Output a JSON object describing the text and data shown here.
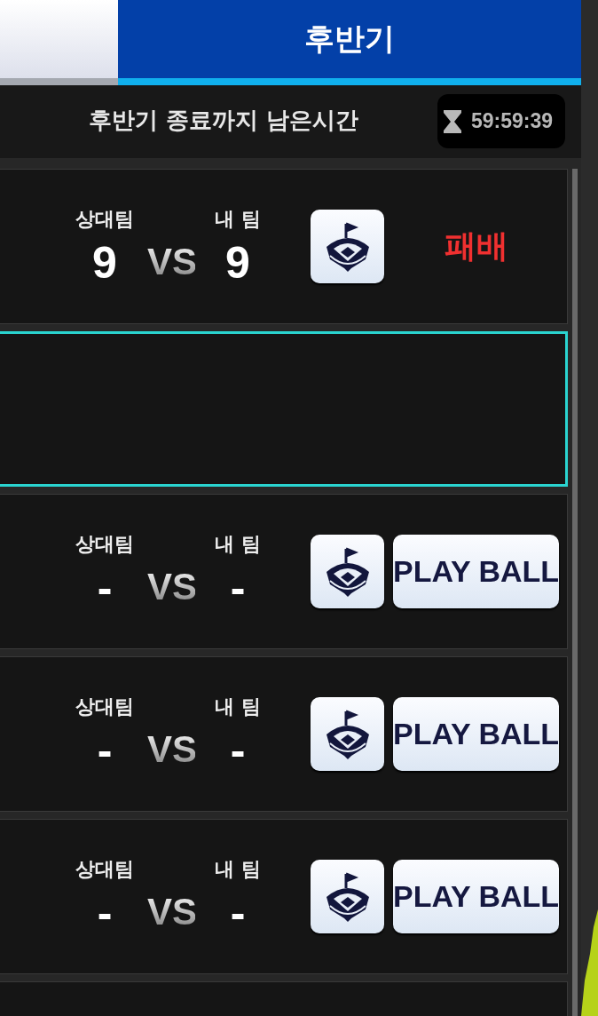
{
  "tabs": [
    {
      "selected": false
    },
    {
      "label": "후반기",
      "selected": true
    }
  ],
  "info_bar": {
    "label": "후반기 종료까지 남은시간",
    "timer": "59:59:39"
  },
  "matches": [
    {
      "kind": "result",
      "selected": false,
      "opponent_label": "상대팀",
      "my_label": "내 팀",
      "opponent_score": "9",
      "vs": "VS",
      "my_score": "9",
      "result": "패배",
      "color": "#f03030"
    },
    {
      "kind": "empty",
      "selected": true
    },
    {
      "kind": "pending",
      "selected": false,
      "opponent_label": "상대팀",
      "my_label": "내 팀",
      "opponent_score": "-",
      "vs": "VS",
      "my_score": "-",
      "button": "PLAY BALL"
    },
    {
      "kind": "pending",
      "selected": false,
      "opponent_label": "상대팀",
      "my_label": "내 팀",
      "opponent_score": "-",
      "vs": "VS",
      "my_score": "-",
      "button": "PLAY BALL"
    },
    {
      "kind": "pending",
      "selected": false,
      "opponent_label": "상대팀",
      "my_label": "내 팀",
      "opponent_score": "-",
      "vs": "VS",
      "my_score": "-",
      "button": "PLAY BALL"
    },
    {
      "kind": "cut",
      "selected": false
    }
  ]
}
